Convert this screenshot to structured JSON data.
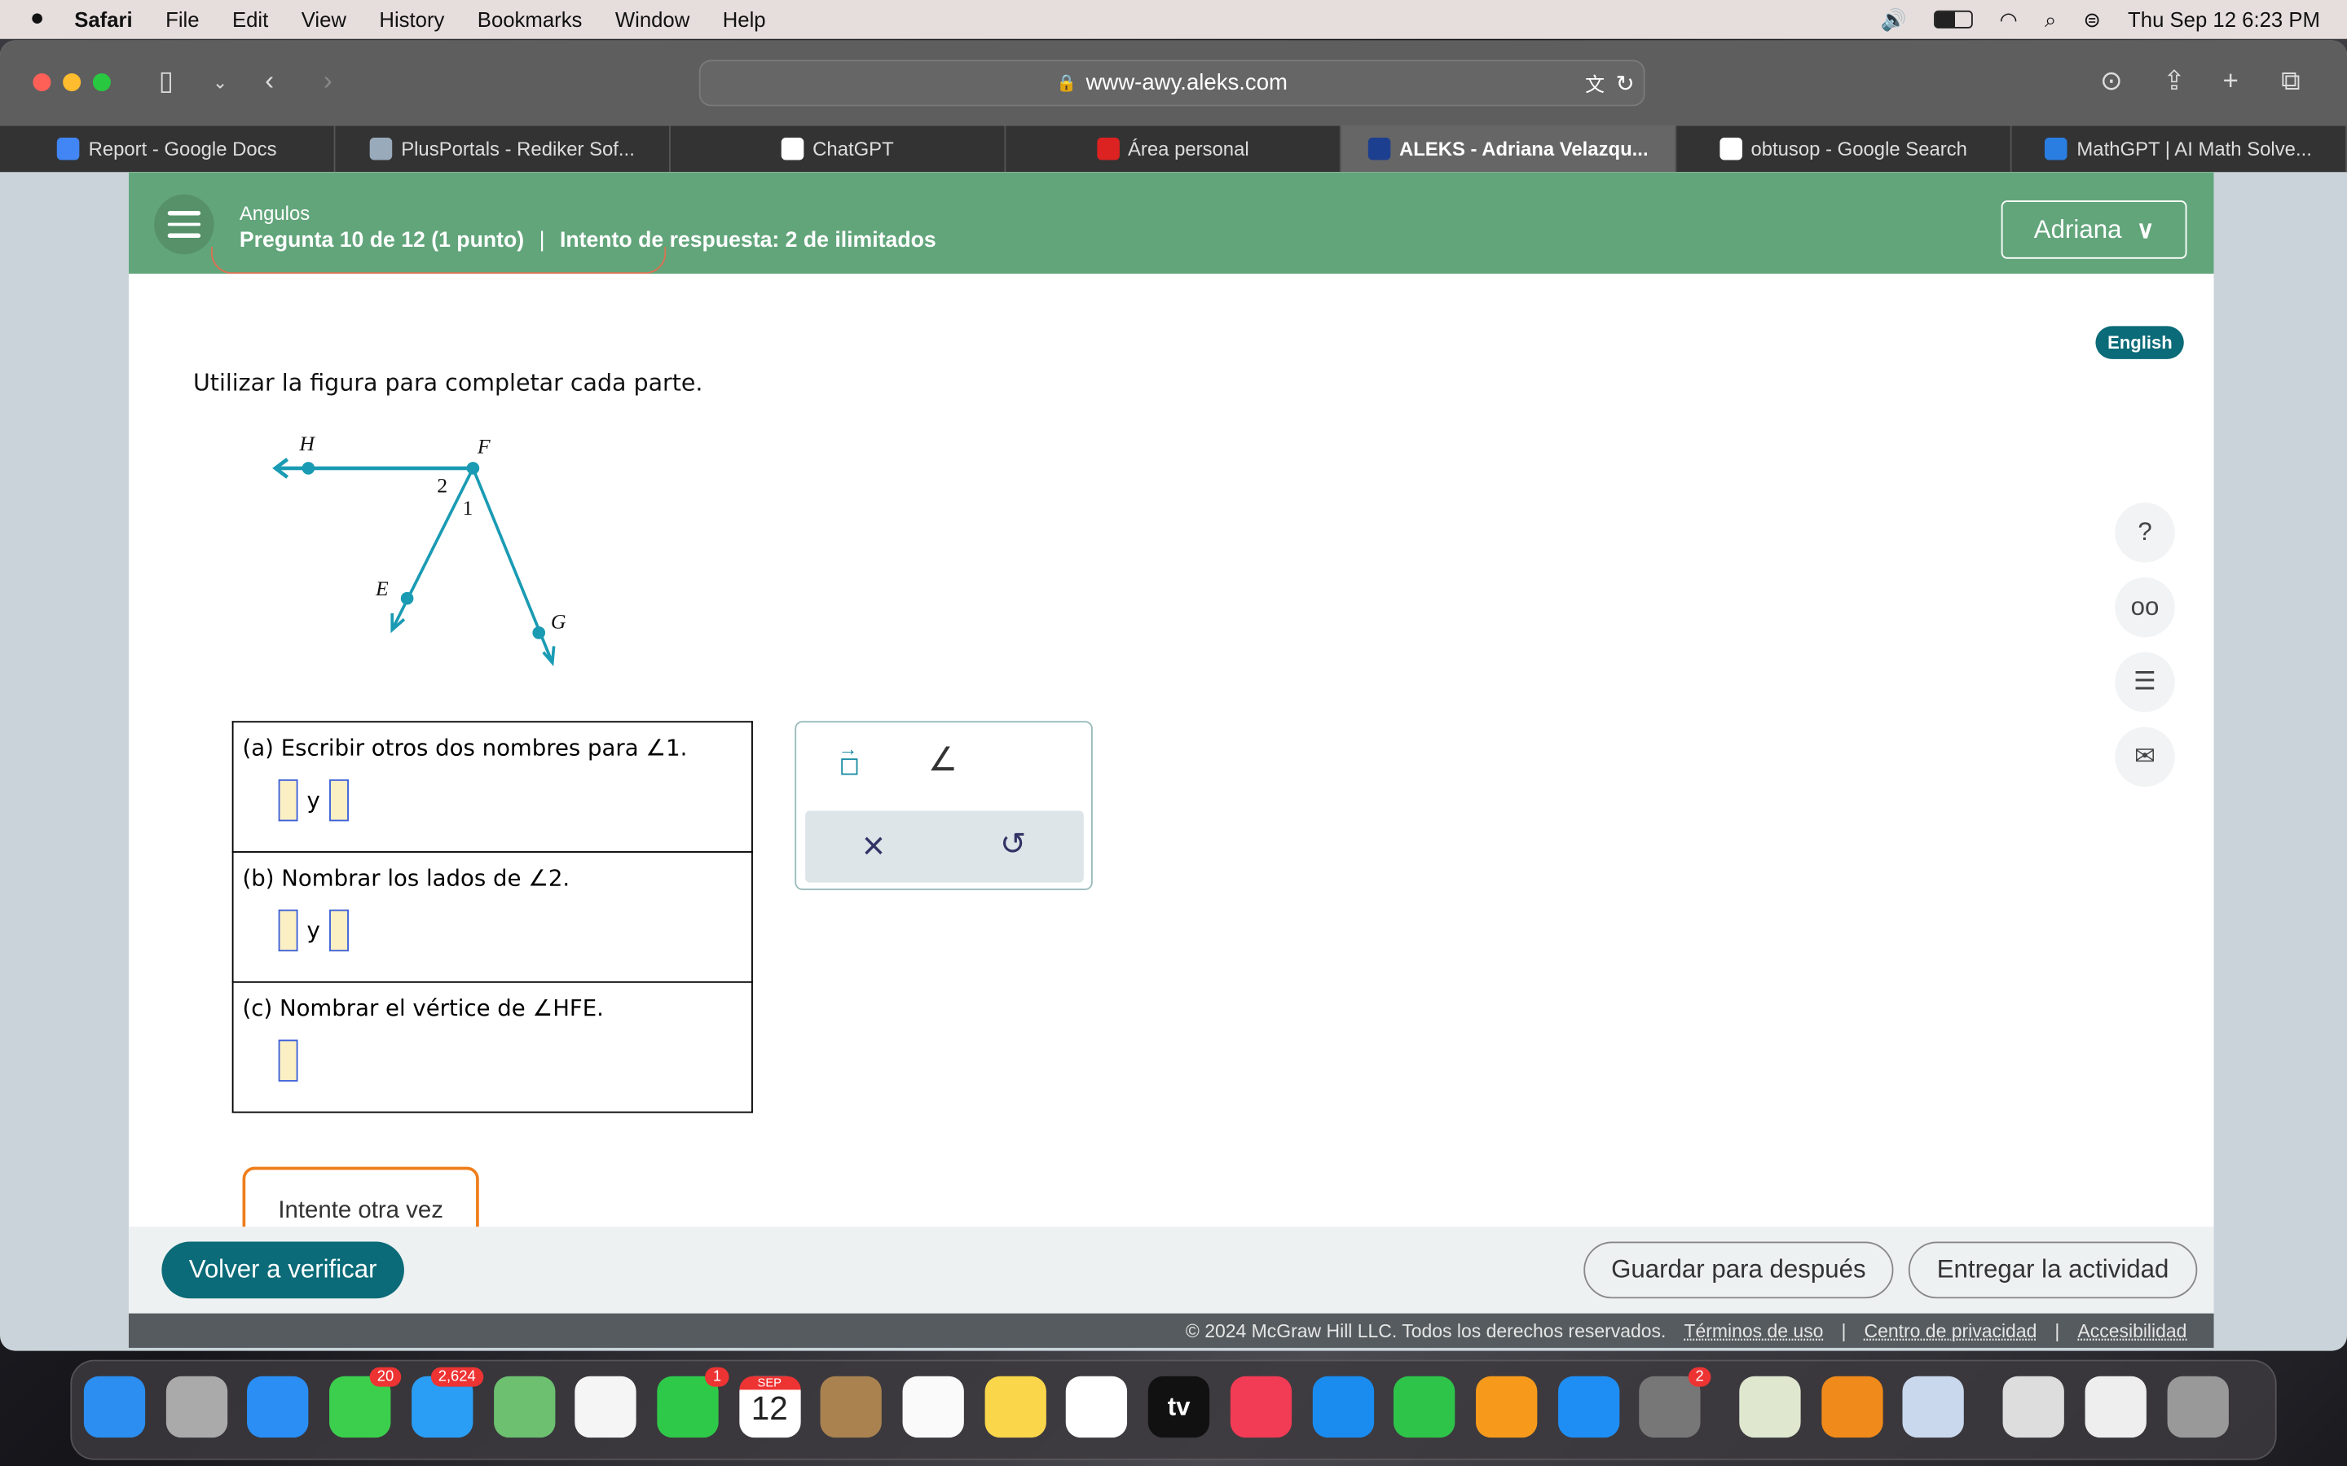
{
  "menubar": {
    "app": "Safari",
    "items": [
      "File",
      "Edit",
      "View",
      "History",
      "Bookmarks",
      "Window",
      "Help"
    ],
    "clock": "Thu Sep 12  6:23 PM"
  },
  "browser": {
    "url": "www-awy.aleks.com",
    "tabs": [
      {
        "label": "Report - Google Docs",
        "color": "#4285f4"
      },
      {
        "label": "PlusPortals - Rediker Sof...",
        "color": "#9ab"
      },
      {
        "label": "ChatGPT",
        "color": "#fff"
      },
      {
        "label": "Área personal",
        "color": "#d22"
      },
      {
        "label": "ALEKS - Adriana Velazqu...",
        "color": "#1d3f8f",
        "active": true
      },
      {
        "label": "obtusop - Google Search",
        "color": "#fff"
      },
      {
        "label": "MathGPT | AI Math Solve...",
        "color": "#2a7de1"
      }
    ]
  },
  "header": {
    "topic": "Angulos",
    "question": "Pregunta 10 de 12 (1 punto)",
    "separator": "|",
    "attempt": "Intento de respuesta: 2 de ilimitados",
    "user": "Adriana"
  },
  "language_button": "English",
  "instruction": "Utilizar la figura para completar cada parte.",
  "figure": {
    "labels": {
      "H": "H",
      "F": "F",
      "E": "E",
      "G": "G",
      "a1": "1",
      "a2": "2"
    },
    "color": "#1a9bb3"
  },
  "parts": [
    {
      "prompt": "(a) Escribir otros dos nombres para ∠1.",
      "connector": "y"
    },
    {
      "prompt": "(b) Nombrar los lados de ∠2.",
      "connector": "y"
    },
    {
      "prompt": "(c) Nombrar el vértice de ∠HFE."
    }
  ],
  "palette": {
    "ray": "⃗",
    "angle": "∠",
    "clear": "×",
    "undo": "↺"
  },
  "feedback": "Intente otra vez",
  "footer": {
    "recheck": "Volver a verificar",
    "save": "Guardar para después",
    "submit": "Entregar la actividad"
  },
  "copyright": {
    "text": "© 2024 McGraw Hill LLC. Todos los derechos reservados.",
    "links": [
      "Términos de uso",
      "Centro de privacidad",
      "Accesibilidad"
    ],
    "sep": "|"
  },
  "dock": [
    {
      "name": "finder",
      "color": "#2b8ef0"
    },
    {
      "name": "launchpad",
      "color": "#aaa"
    },
    {
      "name": "safari",
      "color": "#2a8ef5"
    },
    {
      "name": "messages",
      "color": "#3ccf4e",
      "badge": "20"
    },
    {
      "name": "mail",
      "color": "#2a9ef5",
      "badge": "2,624"
    },
    {
      "name": "maps",
      "color": "#6cc070"
    },
    {
      "name": "photos",
      "color": "#f5f5f5"
    },
    {
      "name": "facetime",
      "color": "#2fc94a",
      "badge": "1"
    },
    {
      "name": "calendar",
      "color": "#fff",
      "text": "12",
      "month": "SEP"
    },
    {
      "name": "contacts",
      "color": "#a98250"
    },
    {
      "name": "reminders",
      "color": "#fafafa"
    },
    {
      "name": "notes",
      "color": "#f9d64a"
    },
    {
      "name": "freeform",
      "color": "#fff"
    },
    {
      "name": "tv",
      "color": "#111",
      "text": "tv"
    },
    {
      "name": "music",
      "color": "#f23b55"
    },
    {
      "name": "keynote",
      "color": "#1a8cf0"
    },
    {
      "name": "numbers",
      "color": "#2ec44a"
    },
    {
      "name": "pages",
      "color": "#f79a1c"
    },
    {
      "name": "app-store",
      "color": "#1e8ef5"
    },
    {
      "name": "system-settings",
      "color": "#777",
      "badge": "2"
    },
    {
      "name": "bookshelf",
      "color": "#dfe8cf"
    },
    {
      "name": "basketball",
      "color": "#f08a1a"
    },
    {
      "name": "preview",
      "color": "#c9d8ec"
    },
    {
      "name": "window-1",
      "color": "#ddd"
    },
    {
      "name": "window-2",
      "color": "#eee"
    },
    {
      "name": "trash",
      "color": "#999"
    }
  ]
}
